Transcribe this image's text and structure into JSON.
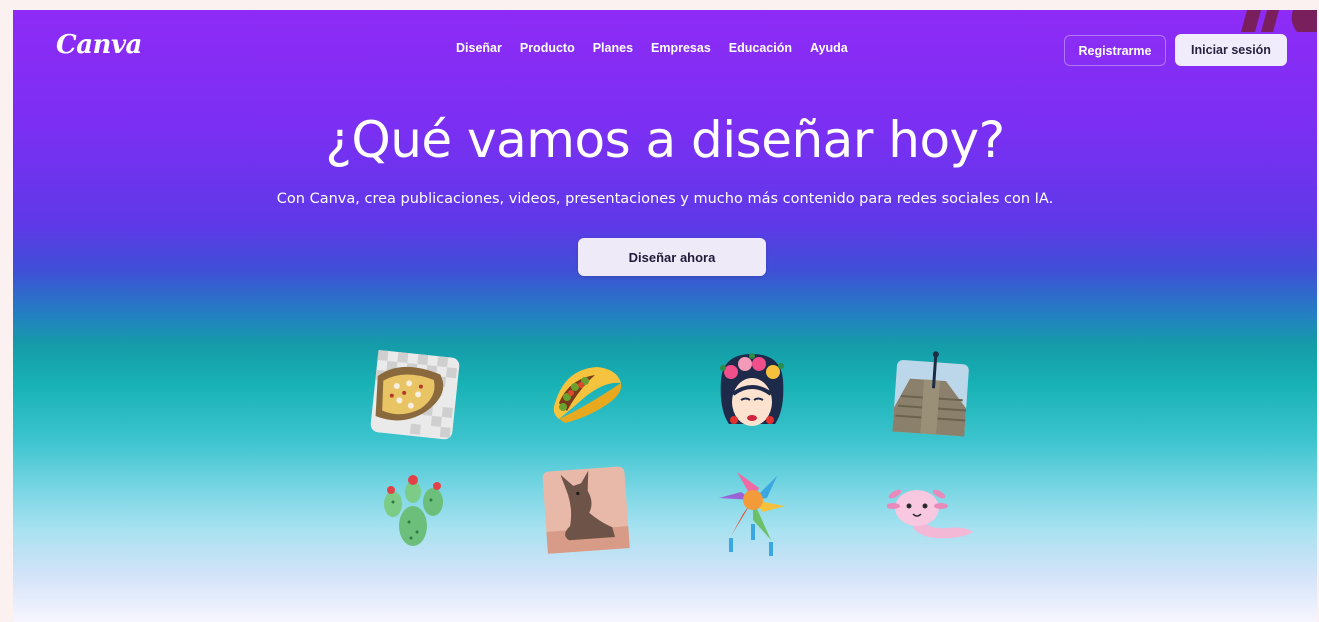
{
  "header": {
    "logo": "Canva",
    "nav": [
      {
        "label": "Diseñar"
      },
      {
        "label": "Producto"
      },
      {
        "label": "Planes"
      },
      {
        "label": "Empresas"
      },
      {
        "label": "Educación"
      },
      {
        "label": "Ayuda"
      }
    ],
    "register_label": "Registrarme",
    "login_label": "Iniciar sesión"
  },
  "hero": {
    "title": "¿Qué vamos a diseñar hoy?",
    "subtitle": "Con Canva, crea publicaciones, videos, presentaciones y mucho más contenido para redes sociales con IA.",
    "cta_label": "Diseñar ahora"
  },
  "stickers": [
    {
      "icon": "elote-corn-image"
    },
    {
      "icon": "taco-icon"
    },
    {
      "icon": "frida-illustration"
    },
    {
      "icon": "pyramid-photo"
    },
    {
      "icon": "cactus-icon"
    },
    {
      "icon": "xolo-dog-photo"
    },
    {
      "icon": "pinata-icon"
    },
    {
      "icon": "axolotl-icon"
    }
  ],
  "colors": {
    "gradient_top": "#8e2bf6",
    "gradient_mid": "#18b2b5",
    "gradient_bottom": "#f7f6ff",
    "button_light": "#f1ecfb",
    "text_dark": "#241a3a"
  }
}
